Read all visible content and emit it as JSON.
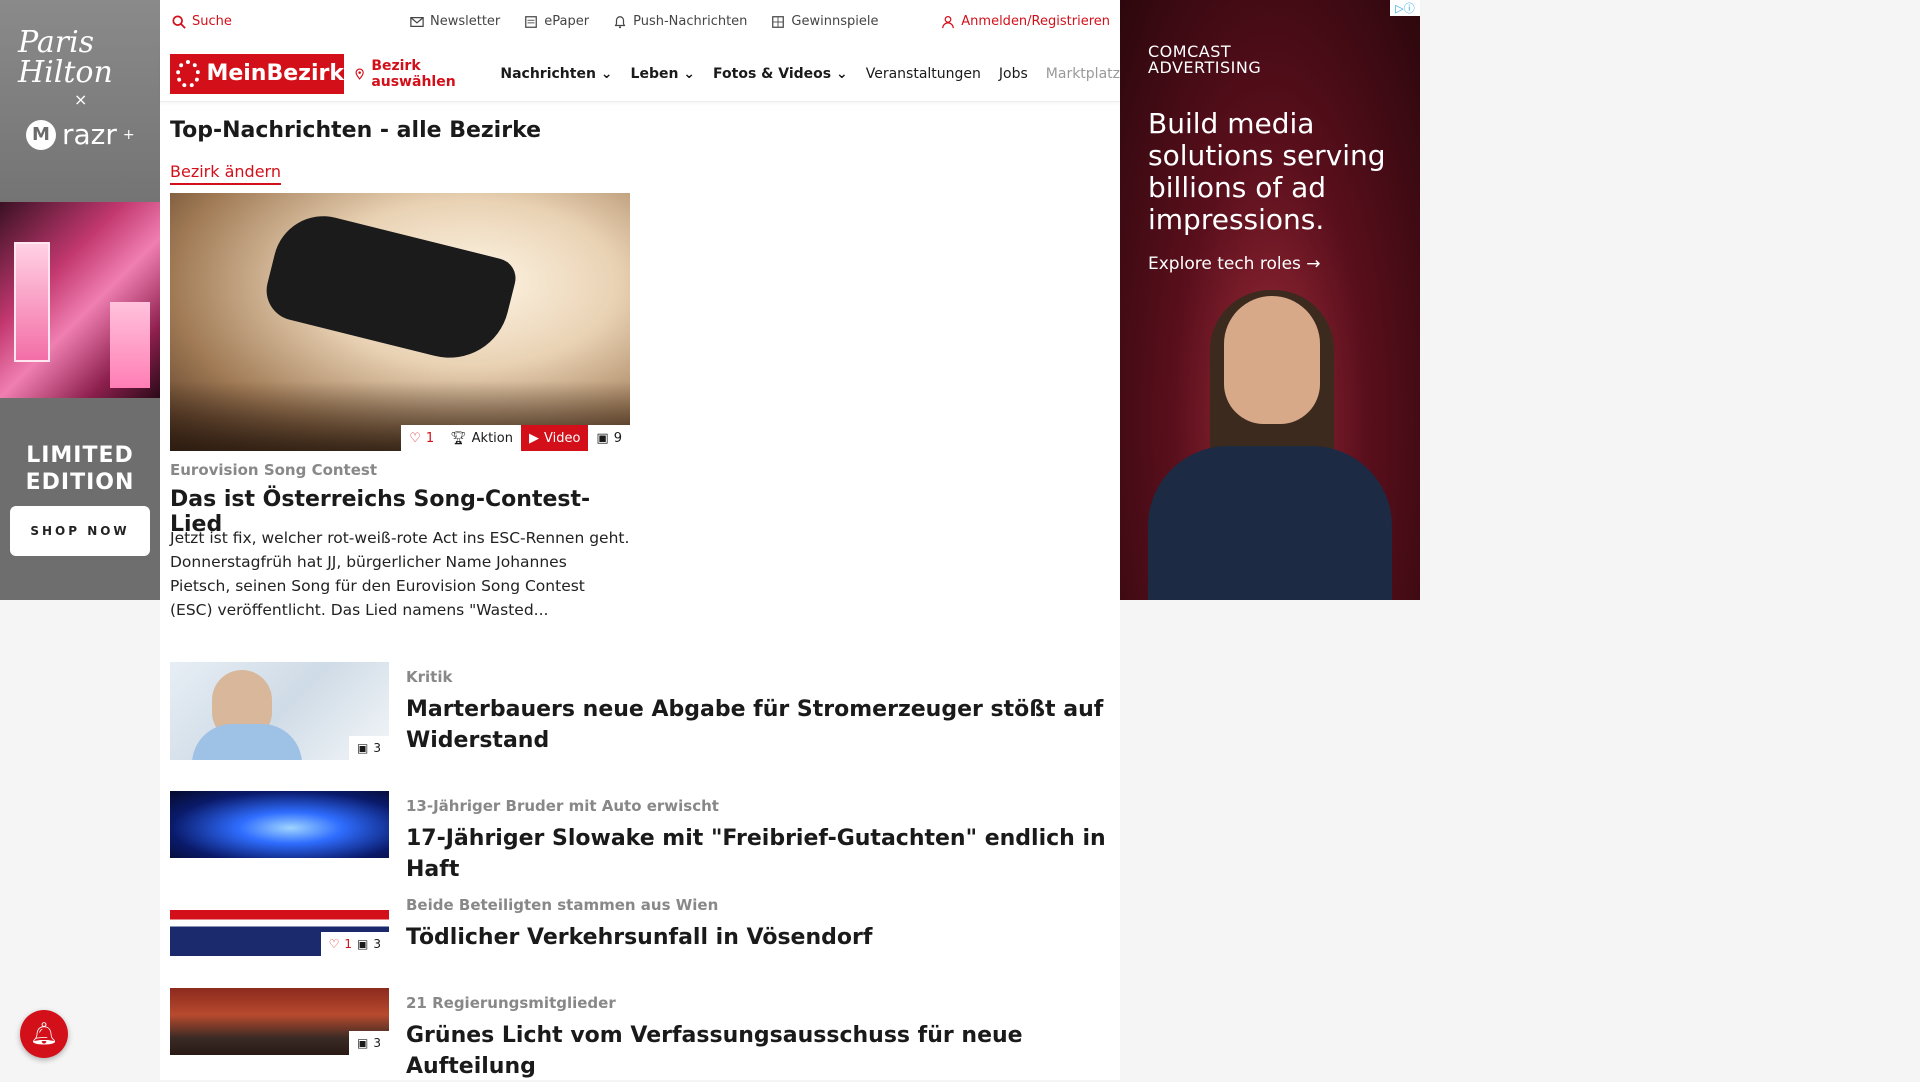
{
  "ad_left": {
    "brand_signature": "Paris Hilton",
    "collab_x": "×",
    "partner": "razr",
    "partner_plus": "+",
    "headline": "LIMITED EDITION",
    "button": "SHOP NOW"
  },
  "ad_right": {
    "brand": "COMCAST ADVERTISING",
    "headline": "Build media solutions serving billions of ad impressions.",
    "cta": "Explore tech roles →"
  },
  "utility": {
    "search": "Suche",
    "newsletter": "Newsletter",
    "epaper": "ePaper",
    "push": "Push-Nachrichten",
    "gewinnspiele": "Gewinnspiele",
    "login": "Anmelden/Registrieren"
  },
  "nav": {
    "logo": "MeinBezirk",
    "bezirk": "Bezirk auswählen",
    "items": [
      "Nachrichten",
      "Leben",
      "Fotos & Videos",
      "Veranstaltungen",
      "Jobs",
      "Marktplatz"
    ]
  },
  "section": {
    "title": "Top-Nachrichten - alle Bezirke",
    "change": "Bezirk ändern"
  },
  "lead": {
    "badges": {
      "likes": "1",
      "aktion": "Aktion",
      "video": "Video",
      "photos": "9"
    },
    "kicker": "Eurovision Song Contest",
    "title": "Das ist Österreichs Song-Contest-Lied",
    "teaser": "Jetzt ist fix, welcher rot-weiß-rote Act ins ESC-Rennen geht. Donnerstagfrüh hat JJ, bürgerlicher Name Johannes Pietsch, seinen Song für den Eurovision Song Contest (ESC) veröffentlicht. Das Lied namens \"Wasted..."
  },
  "articles": [
    {
      "kicker": "Kritik",
      "title": "Marterbauers neue Abgabe für Stromerzeuger stößt auf Widerstand",
      "photos": "3",
      "likes": ""
    },
    {
      "kicker": "13-Jähriger Bruder mit Auto erwischt",
      "title": "17-Jähriger Slowake mit \"Freibrief-Gutachten\" endlich in Haft",
      "photos": "",
      "likes": ""
    },
    {
      "kicker": "Beide Beteiligten stammen aus Wien",
      "title": "Tödlicher Verkehrsunfall in Vösendorf",
      "photos": "3",
      "likes": "1"
    },
    {
      "kicker": "21 Regierungsmitglieder",
      "title": "Grünes Licht vom Verfassungsausschuss für neue Aufteilung",
      "photos": "3",
      "likes": ""
    }
  ],
  "colors": {
    "brand_red": "#d3101a"
  }
}
